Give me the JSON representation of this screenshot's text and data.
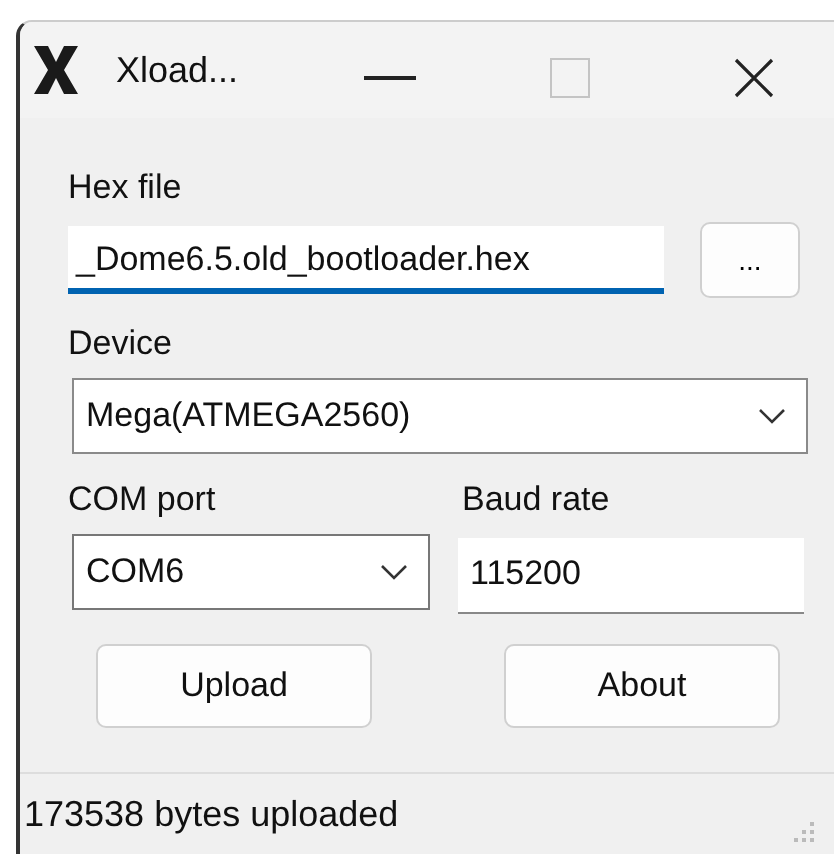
{
  "window": {
    "title": "Xload..."
  },
  "hex_file": {
    "label": "Hex file",
    "value": "_Dome6.5.old_bootloader.hex",
    "focused": true,
    "browse_button": "..."
  },
  "device": {
    "label": "Device",
    "value": "Mega(ATMEGA2560)"
  },
  "com_port": {
    "label": "COM port",
    "value": "COM6"
  },
  "baud_rate": {
    "label": "Baud rate",
    "value": "115200"
  },
  "buttons": [
    "Upload",
    "About"
  ],
  "status_bar": {
    "text": "173538 bytes uploaded"
  }
}
